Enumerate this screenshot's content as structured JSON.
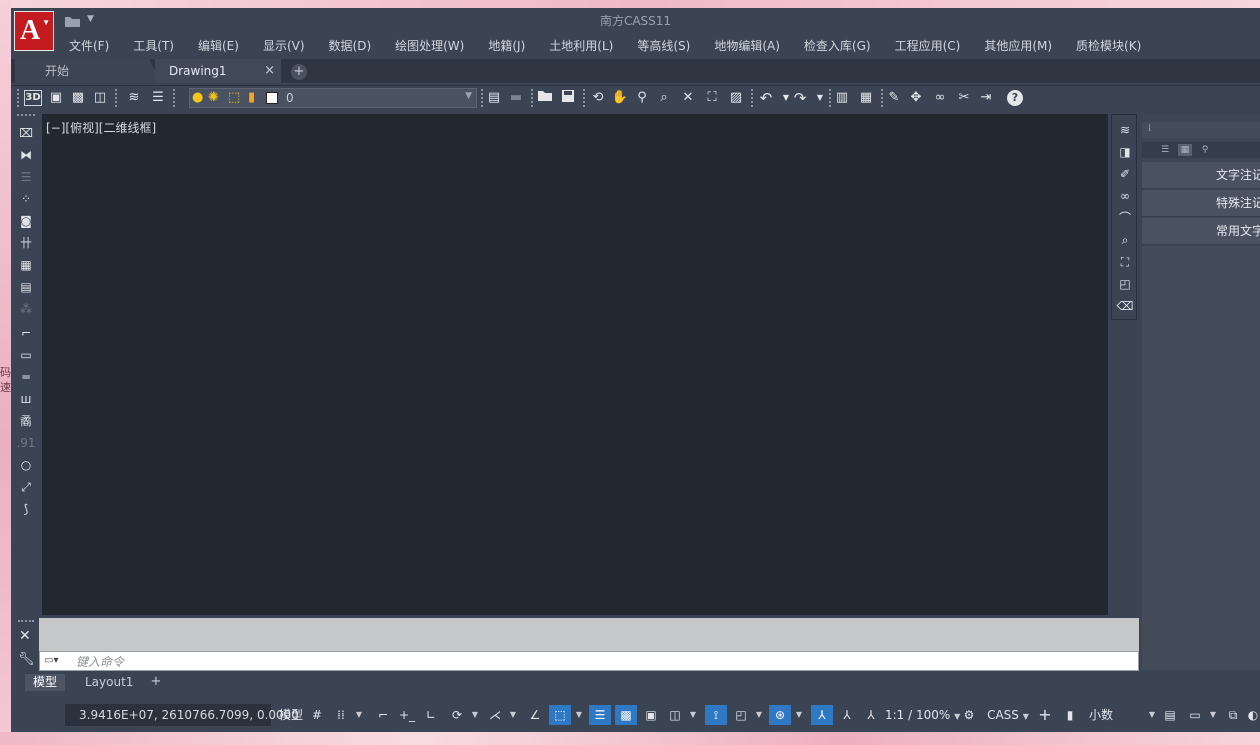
{
  "app": {
    "title": "南方CASS11",
    "logo_letter": "A"
  },
  "menu": [
    "文件(F)",
    "工具(T)",
    "编辑(E)",
    "显示(V)",
    "数据(D)",
    "绘图处理(W)",
    "地籍(J)",
    "土地利用(L)",
    "等高线(S)",
    "地物编辑(A)",
    "检查入库(G)",
    "工程应用(C)",
    "其他应用(M)",
    "质检模块(K)"
  ],
  "tabs": {
    "start": "开始",
    "drawing": "Drawing1",
    "close_glyph": "×",
    "add_glyph": "+"
  },
  "toolbar": {
    "view_3d_label": "3D",
    "layer_current": "0"
  },
  "canvas": {
    "viewport_label": "[−][俯视][二维线框]"
  },
  "palette": {
    "items": [
      "文字注记",
      "特殊注记",
      "常用文字"
    ]
  },
  "command": {
    "placeholder": "键入命令"
  },
  "layout_tabs": {
    "model": "模型",
    "layout1": "Layout1",
    "add": "+"
  },
  "status": {
    "coordinates": "3.9416E+07, 2610766.7099, 0.0000",
    "model_label": "模型",
    "scale": "1:1 / 100%",
    "workspace": "CASS",
    "units": "小数"
  },
  "desktop": {
    "fragments": [
      "码",
      "速"
    ]
  },
  "colors": {
    "accent_blue": "#2f78c4",
    "logo_red": "#c41b20",
    "canvas_bg": "#212830"
  }
}
